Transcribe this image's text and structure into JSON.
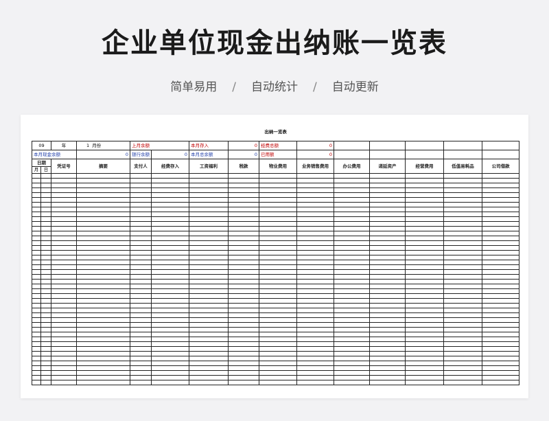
{
  "header": {
    "title": "企业单位现金出纳账一览表",
    "features": [
      "简单易用",
      "自动统计",
      "自动更新"
    ],
    "separator": "/"
  },
  "sheet": {
    "title": "出纳一览表",
    "period": {
      "year": "09",
      "year_unit": "年",
      "month": "1",
      "month_unit": "月份"
    },
    "info_row1": [
      {
        "label": "上月余额",
        "value": ""
      },
      {
        "label": "本月存入",
        "value": "0"
      },
      {
        "label": "经费总额",
        "value": "0"
      }
    ],
    "info_row2": [
      {
        "label": "本月现金余额",
        "value": "0"
      },
      {
        "label": "银行余额",
        "value": "0"
      },
      {
        "label": "本月总余额",
        "value": "0"
      },
      {
        "label": "已用额",
        "value": "0"
      }
    ],
    "columns": {
      "date": "日期",
      "month": "月",
      "day": "日",
      "voucher": "凭证号",
      "summary": "摘要",
      "payer": "支付人",
      "funds_in": "经费存入",
      "wages": "工资福利",
      "tax": "税款",
      "property": "物业费用",
      "sales": "业务销售费用",
      "office": "办公费用",
      "deferred": "递延资产",
      "operating": "经营费用",
      "low_value": "低值易耗品",
      "loan": "公司借款"
    },
    "colors": {
      "red": "#c00000",
      "blue": "#1f3ea8"
    }
  }
}
